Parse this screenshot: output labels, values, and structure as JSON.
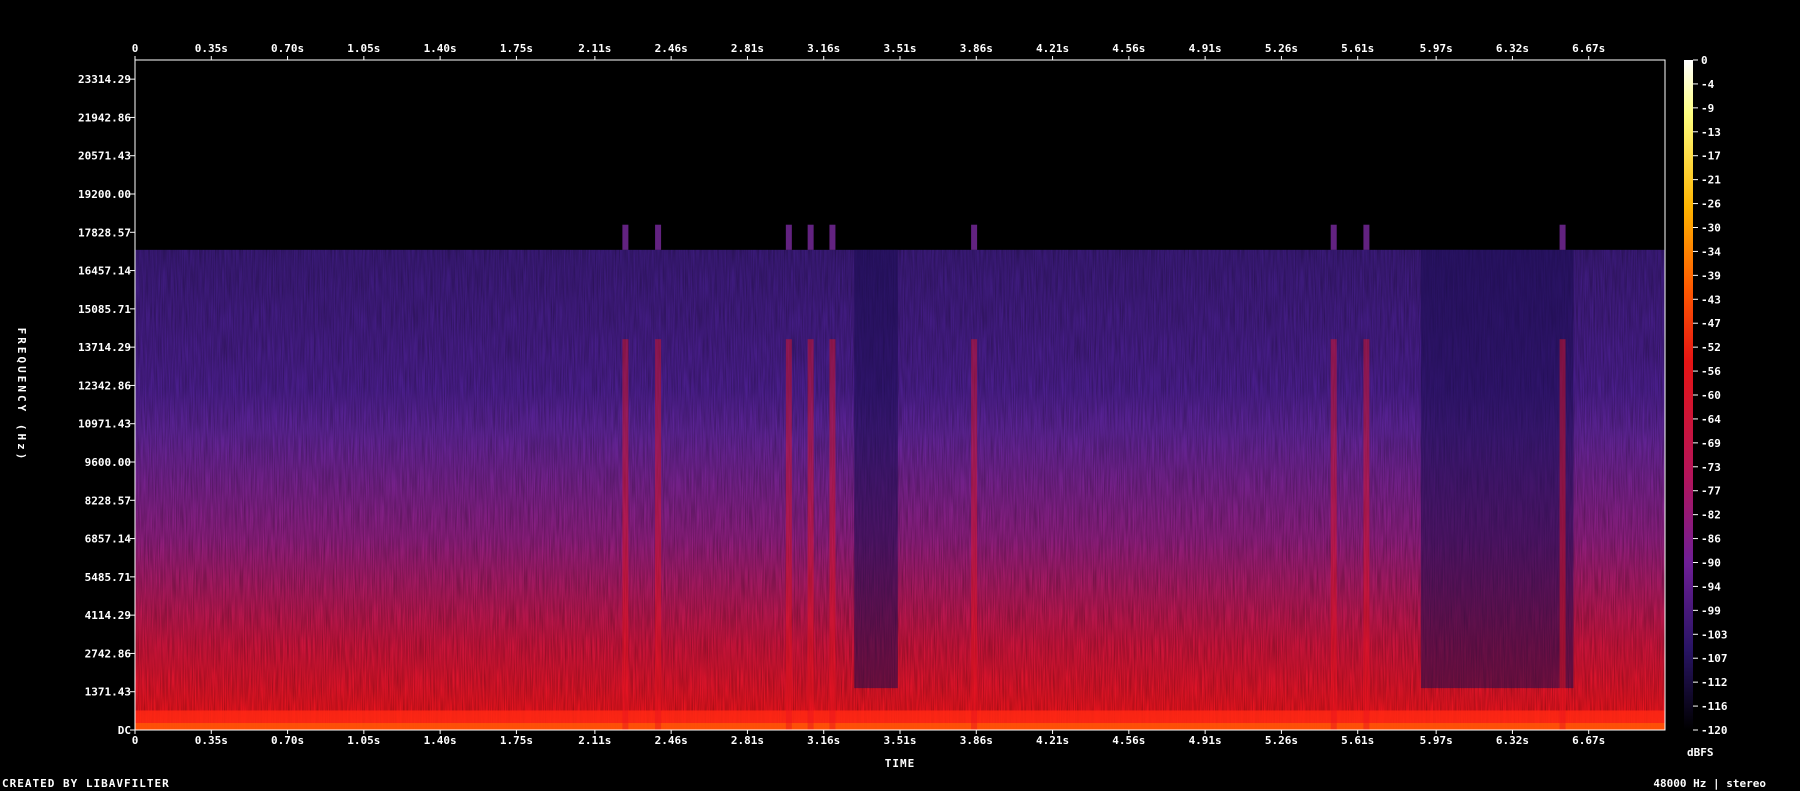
{
  "chart_data": {
    "type": "heatmap",
    "title": "",
    "xlabel": "TIME",
    "ylabel": "FREQUENCY (Hz)",
    "colorbar_label": "dBFS",
    "x_ticks_top": [
      "0",
      "0.35s",
      "0.70s",
      "1.05s",
      "1.40s",
      "1.75s",
      "2.11s",
      "2.46s",
      "2.81s",
      "3.16s",
      "3.51s",
      "3.86s",
      "4.21s",
      "4.56s",
      "4.91s",
      "5.26s",
      "5.61s",
      "5.97s",
      "6.32s",
      "6.67s"
    ],
    "x_ticks_bottom": [
      "0",
      "0.35s",
      "0.70s",
      "1.05s",
      "1.40s",
      "1.75s",
      "2.11s",
      "2.46s",
      "2.81s",
      "3.16s",
      "3.51s",
      "3.86s",
      "4.21s",
      "4.56s",
      "4.91s",
      "5.26s",
      "5.61s",
      "5.97s",
      "6.32s",
      "6.67s"
    ],
    "x_tick_values": [
      0,
      0.35,
      0.7,
      1.05,
      1.4,
      1.75,
      2.11,
      2.46,
      2.81,
      3.16,
      3.51,
      3.86,
      4.21,
      4.56,
      4.91,
      5.26,
      5.61,
      5.97,
      6.32,
      6.67
    ],
    "xlim": [
      0,
      7.02
    ],
    "y_ticks": [
      "DC",
      "1371.43",
      "2742.86",
      "4114.29",
      "5485.71",
      "6857.14",
      "8228.57",
      "9600.00",
      "10971.43",
      "12342.86",
      "13714.29",
      "15085.71",
      "16457.14",
      "17828.57",
      "19200.00",
      "20571.43",
      "21942.86",
      "23314.29"
    ],
    "y_tick_values": [
      0,
      1371.43,
      2742.86,
      4114.29,
      5485.71,
      6857.14,
      8228.57,
      9600,
      10971.43,
      12342.86,
      13714.29,
      15085.71,
      16457.14,
      17828.57,
      19200,
      20571.43,
      21942.86,
      23314.29
    ],
    "ylim": [
      0,
      24000
    ],
    "cutoff_frequency_hz": 17200,
    "colorbar_ticks": [
      "0",
      "-4",
      "-9",
      "-13",
      "-17",
      "-21",
      "-26",
      "-30",
      "-34",
      "-39",
      "-43",
      "-47",
      "-52",
      "-56",
      "-60",
      "-64",
      "-69",
      "-73",
      "-77",
      "-82",
      "-86",
      "-90",
      "-94",
      "-99",
      "-103",
      "-107",
      "-112",
      "-116",
      "-120"
    ],
    "colorbar_range_dbfs": [
      -120,
      0
    ],
    "colormap": [
      "#000000",
      "#1a0a4a",
      "#4a1a8a",
      "#8a1a9a",
      "#c8145a",
      "#e61414",
      "#ff5a00",
      "#ffb400",
      "#ffff64",
      "#ffffff"
    ],
    "loud_bursts_seconds": [
      2.25,
      2.4,
      3.0,
      3.1,
      3.2,
      3.85,
      5.5,
      5.65,
      6.55
    ],
    "quiet_regions_seconds": [
      [
        3.3,
        3.5
      ],
      [
        5.9,
        6.6
      ]
    ]
  },
  "footer": {
    "created_by": "CREATED BY LIBAVFILTER",
    "format": "48000 Hz | stereo"
  }
}
